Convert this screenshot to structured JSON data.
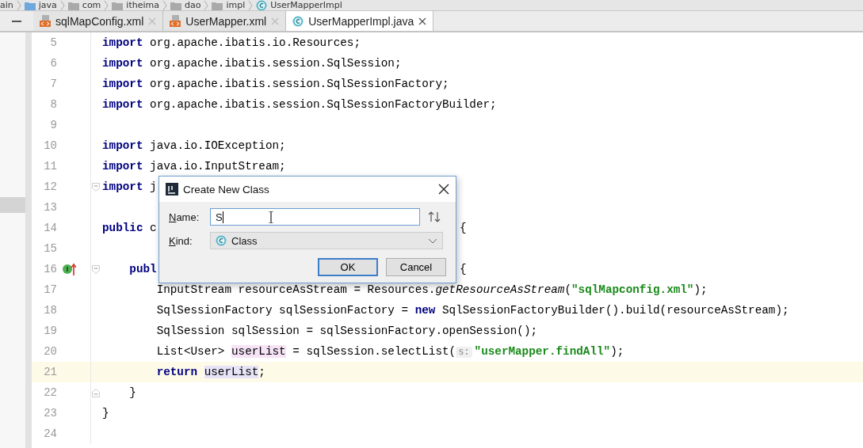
{
  "breadcrumbs": [
    {
      "label": "ain",
      "kind": "plain"
    },
    {
      "label": "java",
      "kind": "source-root"
    },
    {
      "label": "com",
      "kind": "package"
    },
    {
      "label": "itheima",
      "kind": "package"
    },
    {
      "label": "dao",
      "kind": "package"
    },
    {
      "label": "impl",
      "kind": "package"
    },
    {
      "label": "UserMapperImpl",
      "kind": "class"
    }
  ],
  "tabs": [
    {
      "label": "sqlMapConfig.xml",
      "kind": "xml",
      "selected": false
    },
    {
      "label": "UserMapper.xml",
      "kind": "xml",
      "selected": false
    },
    {
      "label": "UserMapperImpl.java",
      "kind": "class",
      "selected": true
    }
  ],
  "editor": {
    "lines": [
      {
        "number": "5",
        "current": false,
        "tokens": [
          {
            "text": "import",
            "kind": "kw"
          },
          {
            "text": " org.apache.ibatis.io.Resources;",
            "kind": "plain"
          }
        ]
      },
      {
        "number": "6",
        "current": false,
        "tokens": [
          {
            "text": "import",
            "kind": "kw"
          },
          {
            "text": " org.apache.ibatis.session.SqlSession;",
            "kind": "plain"
          }
        ]
      },
      {
        "number": "7",
        "current": false,
        "tokens": [
          {
            "text": "import",
            "kind": "kw"
          },
          {
            "text": " org.apache.ibatis.session.SqlSessionFactory;",
            "kind": "plain"
          }
        ]
      },
      {
        "number": "8",
        "current": false,
        "tokens": [
          {
            "text": "import",
            "kind": "kw"
          },
          {
            "text": " org.apache.ibatis.session.SqlSessionFactoryBuilder;",
            "kind": "plain"
          }
        ]
      },
      {
        "number": "9",
        "current": false
      },
      {
        "number": "10",
        "current": false,
        "tokens": [
          {
            "text": "import",
            "kind": "kw"
          },
          {
            "text": " java.io.IOException;",
            "kind": "plain"
          }
        ]
      },
      {
        "number": "11",
        "current": false,
        "tokens": [
          {
            "text": "import",
            "kind": "kw"
          },
          {
            "text": " java.io.InputStream;",
            "kind": "plain"
          }
        ]
      },
      {
        "number": "12",
        "current": false,
        "fold_start": true,
        "tokens": [
          {
            "text": "import",
            "kind": "kw"
          },
          {
            "text": " j",
            "kind": "plain"
          }
        ]
      },
      {
        "number": "13",
        "current": false
      },
      {
        "number": "14",
        "current": false,
        "tokens": [
          {
            "text": "public",
            "kind": "kw"
          },
          {
            "text": " c",
            "kind": "plain"
          }
        ],
        "right": "{"
      },
      {
        "number": "15",
        "current": false
      },
      {
        "number": "16",
        "current": false,
        "fold_start": true,
        "implements": true,
        "tokens": [
          {
            "text": "    publ",
            "kind": "kw"
          }
        ],
        "right": "{"
      },
      {
        "number": "17",
        "current": false,
        "tokens": [
          {
            "text": "        InputStream resourceAsStream = Resources.",
            "kind": "plain"
          },
          {
            "text": "getResourceAsStream",
            "kind": "italic"
          },
          {
            "text": "(",
            "kind": "plain"
          },
          {
            "text": "\"sqlMapconfig.xml\"",
            "kind": "str"
          },
          {
            "text": ");",
            "kind": "plain"
          }
        ]
      },
      {
        "number": "18",
        "current": false,
        "tokens": [
          {
            "text": "        SqlSessionFactory sqlSessionFactory = ",
            "kind": "plain"
          },
          {
            "text": "new",
            "kind": "kw"
          },
          {
            "text": " SqlSessionFactoryBuilder().build(resourceAsStream);",
            "kind": "plain"
          }
        ]
      },
      {
        "number": "19",
        "current": false,
        "tokens": [
          {
            "text": "        SqlSession sqlSession = sqlSessionFactory.openSession();",
            "kind": "plain"
          }
        ]
      },
      {
        "number": "20",
        "current": false,
        "tokens": [
          {
            "text": "        List<User> ",
            "kind": "plain"
          },
          {
            "text": "userList",
            "kind": "decl"
          },
          {
            "text": " = sqlSession.selectList(",
            "kind": "plain"
          },
          {
            "text": "s:",
            "kind": "hint"
          },
          {
            "text": "\"userMapper.findAll\"",
            "kind": "str"
          },
          {
            "text": ");",
            "kind": "plain"
          }
        ]
      },
      {
        "number": "21",
        "current": true,
        "tokens": [
          {
            "text": "        return ",
            "kind": "kw"
          },
          {
            "text": "userList",
            "kind": "use"
          },
          {
            "text": ";",
            "kind": "plain"
          }
        ]
      },
      {
        "number": "22",
        "current": false,
        "fold_end": true,
        "tokens": [
          {
            "text": "    }",
            "kind": "plain"
          }
        ]
      },
      {
        "number": "23",
        "current": false,
        "tokens": [
          {
            "text": "}",
            "kind": "plain"
          }
        ]
      },
      {
        "number": "24",
        "current": false
      }
    ]
  },
  "dialog": {
    "title": "Create New Class",
    "name_label": "Name:",
    "name_value": "S",
    "kind_label": "Kind:",
    "kind_value": "Class",
    "buttons": [
      {
        "label": "OK",
        "default": true
      },
      {
        "label": "Cancel",
        "default": false
      }
    ]
  }
}
